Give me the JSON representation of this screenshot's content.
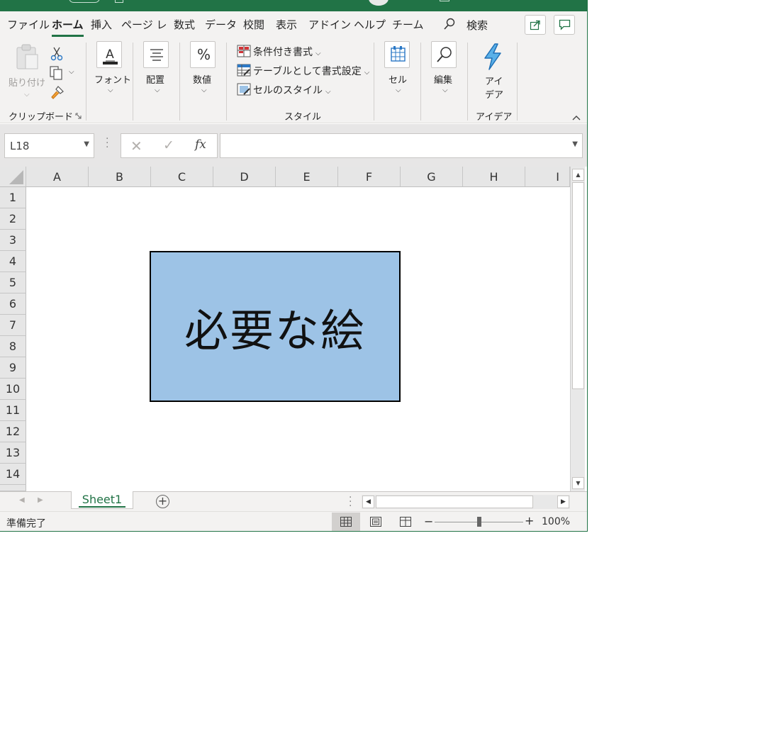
{
  "menu": {
    "tabs": [
      "ファイル",
      "ホーム",
      "挿入",
      "ページ レ",
      "数式",
      "データ",
      "校閲",
      "表示",
      "アドイン",
      "ヘルプ",
      "チーム"
    ],
    "search_label": "検索"
  },
  "ribbon": {
    "paste_label": "貼り付け",
    "clipboard_group": "クリップボード",
    "font_label": "フォント",
    "alignment_label": "配置",
    "number_label": "数値",
    "conditional_format": "条件付き書式",
    "format_as_table": "テーブルとして書式設定",
    "cell_styles": "セルのスタイル",
    "styles_group": "スタイル",
    "cells_label": "セル",
    "editing_label": "編集",
    "ideas_label_1": "アイ",
    "ideas_label_2": "デア",
    "ideas_group": "アイデア",
    "percent_symbol": "%",
    "fx_symbol": "fx"
  },
  "formula_bar": {
    "name_box": "L18",
    "formula": ""
  },
  "grid": {
    "columns": [
      "A",
      "B",
      "C",
      "D",
      "E",
      "F",
      "G",
      "H",
      "I"
    ],
    "rows": [
      "1",
      "2",
      "3",
      "4",
      "5",
      "6",
      "7",
      "8",
      "9",
      "10",
      "11",
      "12",
      "13",
      "14"
    ]
  },
  "shape": {
    "text": "必要な絵",
    "fill_color": "#9dc3e6"
  },
  "sheets": {
    "active": "Sheet1"
  },
  "status": {
    "text": "準備完了",
    "zoom": "100%"
  },
  "colors": {
    "accent": "#217346"
  }
}
